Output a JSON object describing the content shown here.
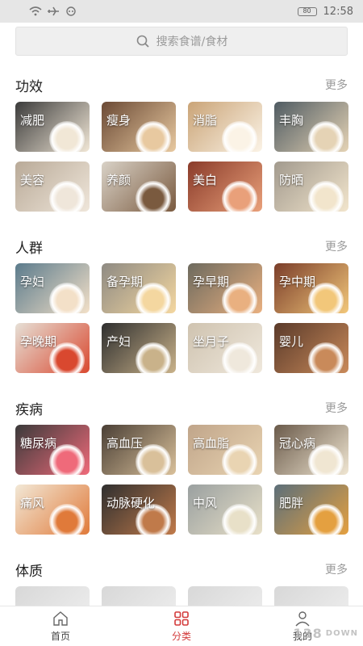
{
  "status_bar": {
    "time": "12:58",
    "battery_label": "80"
  },
  "search": {
    "placeholder": "搜索食谱/食材"
  },
  "sections": [
    {
      "title": "功效",
      "more": "更多",
      "items": [
        "减肥",
        "瘦身",
        "消脂",
        "丰胸",
        "美容",
        "养颜",
        "美白",
        "防晒"
      ]
    },
    {
      "title": "人群",
      "more": "更多",
      "items": [
        "孕妇",
        "备孕期",
        "孕早期",
        "孕中期",
        "孕晚期",
        "产妇",
        "坐月子",
        "婴儿"
      ]
    },
    {
      "title": "疾病",
      "more": "更多",
      "items": [
        "糖尿病",
        "高血压",
        "高血脂",
        "冠心病",
        "痛风",
        "动脉硬化",
        "中风",
        "肥胖"
      ]
    },
    {
      "title": "体质",
      "more": "更多",
      "items": []
    }
  ],
  "bottom_nav": [
    {
      "label": "首页",
      "icon": "home-icon"
    },
    {
      "label": "分类",
      "icon": "grid-icon"
    },
    {
      "label": "我的",
      "icon": "user-icon"
    }
  ],
  "watermark": {
    "num": "138",
    "text": "DOWN"
  },
  "colors": {
    "accent": "#d33a3a"
  }
}
